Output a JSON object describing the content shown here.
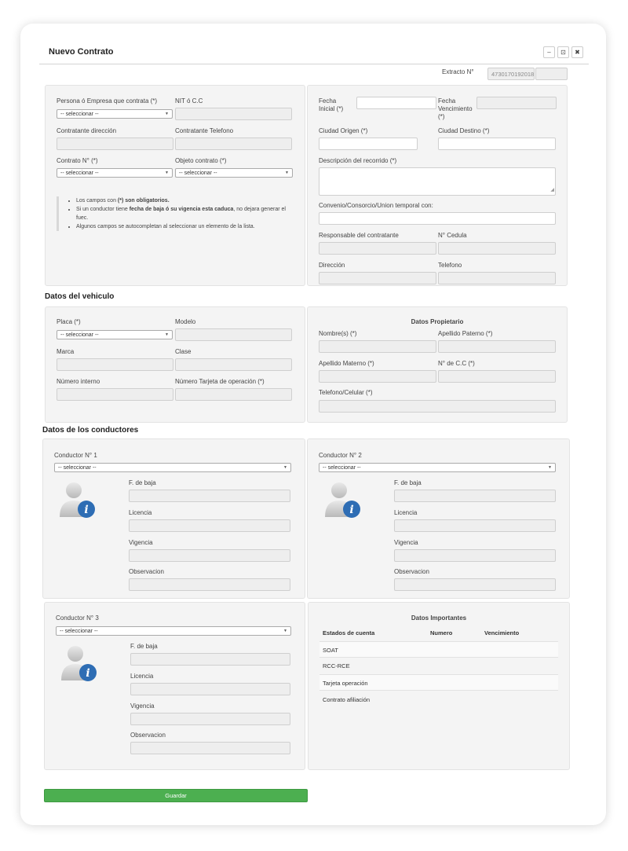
{
  "window": {
    "title": "Nuevo Contrato",
    "minimize_label": "–",
    "restore_label": "⊡",
    "close_label": "✖"
  },
  "extracto": {
    "label": "Extracto N°",
    "value": "4730170192018"
  },
  "contract": {
    "persona_label": "Persona ó Empresa que contrata (*)",
    "persona_select": "-- seleccionar --",
    "nit_label": "NIT ó C.C",
    "direccion_label": "Contratante dirección",
    "telefono_label": "Contratante Telefono",
    "contrato_label": "Contrato N° (*)",
    "contrato_select": "-- seleccionar --",
    "objeto_label": "Objeto contrato (*)",
    "objeto_select": "-- seleccionar --",
    "notes": {
      "n1_pre": "Los campos con ",
      "n1_bold": "(*) son obligatorios.",
      "n2_pre": "Si un conductor tiene ",
      "n2_bold": "fecha de baja ó su vigencia esta caduca",
      "n2_post": ", no dejara generar el fuec.",
      "n3": "Algunos campos se autocompletan al seleccionar un elemento de la lista."
    }
  },
  "trip": {
    "fecha_inicial_label1": "Fecha",
    "fecha_inicial_label2": "Inicial (*)",
    "fecha_venc_label1": "Fecha",
    "fecha_venc_label2": "Vencimiento",
    "fecha_venc_label3": "(*)",
    "ciudad_origen_label": "Ciudad Origen (*)",
    "ciudad_destino_label": "Ciudad Destino (*)",
    "descripcion_label": "Descripción del recorrido (*)",
    "convenio_label": "Convenio/Consorcio/Union temporal con:",
    "responsable_label": "Responsable del contratante",
    "cedula_label": "N° Cedula",
    "direccion_label": "Dirección",
    "telefono_label": "Telefono"
  },
  "vehiculo": {
    "section_title": "Datos del vehiculo",
    "placa_label": "Placa (*)",
    "placa_select": "-- seleccionar --",
    "modelo_label": "Modelo",
    "marca_label": "Marca",
    "clase_label": "Clase",
    "numero_interno_label": "Número interno",
    "tarjeta_label": "Número Tarjeta de operación (*)"
  },
  "propietario": {
    "title": "Datos Propietario",
    "nombres_label": "Nombre(s) (*)",
    "apellido_paterno_label": "Apellido Paterno (*)",
    "apellido_materno_label": "Apellido Materno (*)",
    "cc_label": "N° de C.C (*)",
    "telefono_label": "Telefono/Celular (*)"
  },
  "conductores": {
    "section_title": "Datos de los conductores",
    "c1_label": "Conductor N° 1",
    "c2_label": "Conductor N° 2",
    "c3_label": "Conductor N° 3",
    "select": "-- seleccionar --",
    "baja_label": "F. de baja",
    "licencia_label": "Licencia",
    "vigencia_label": "Vigencia",
    "observacion_label": "Observacion"
  },
  "importantes": {
    "title": "Datos Importantes",
    "col_estados": "Estados de cuenta",
    "col_numero": "Numero",
    "col_vencimiento": "Vencimiento",
    "rows": [
      "SOAT",
      "RCC-RCE",
      "Tarjeta operación",
      "Contrato afiliación"
    ]
  },
  "save_label": "Guardar",
  "colors": {
    "accent_green": "#4caf50",
    "info_blue": "#2e6db4"
  }
}
